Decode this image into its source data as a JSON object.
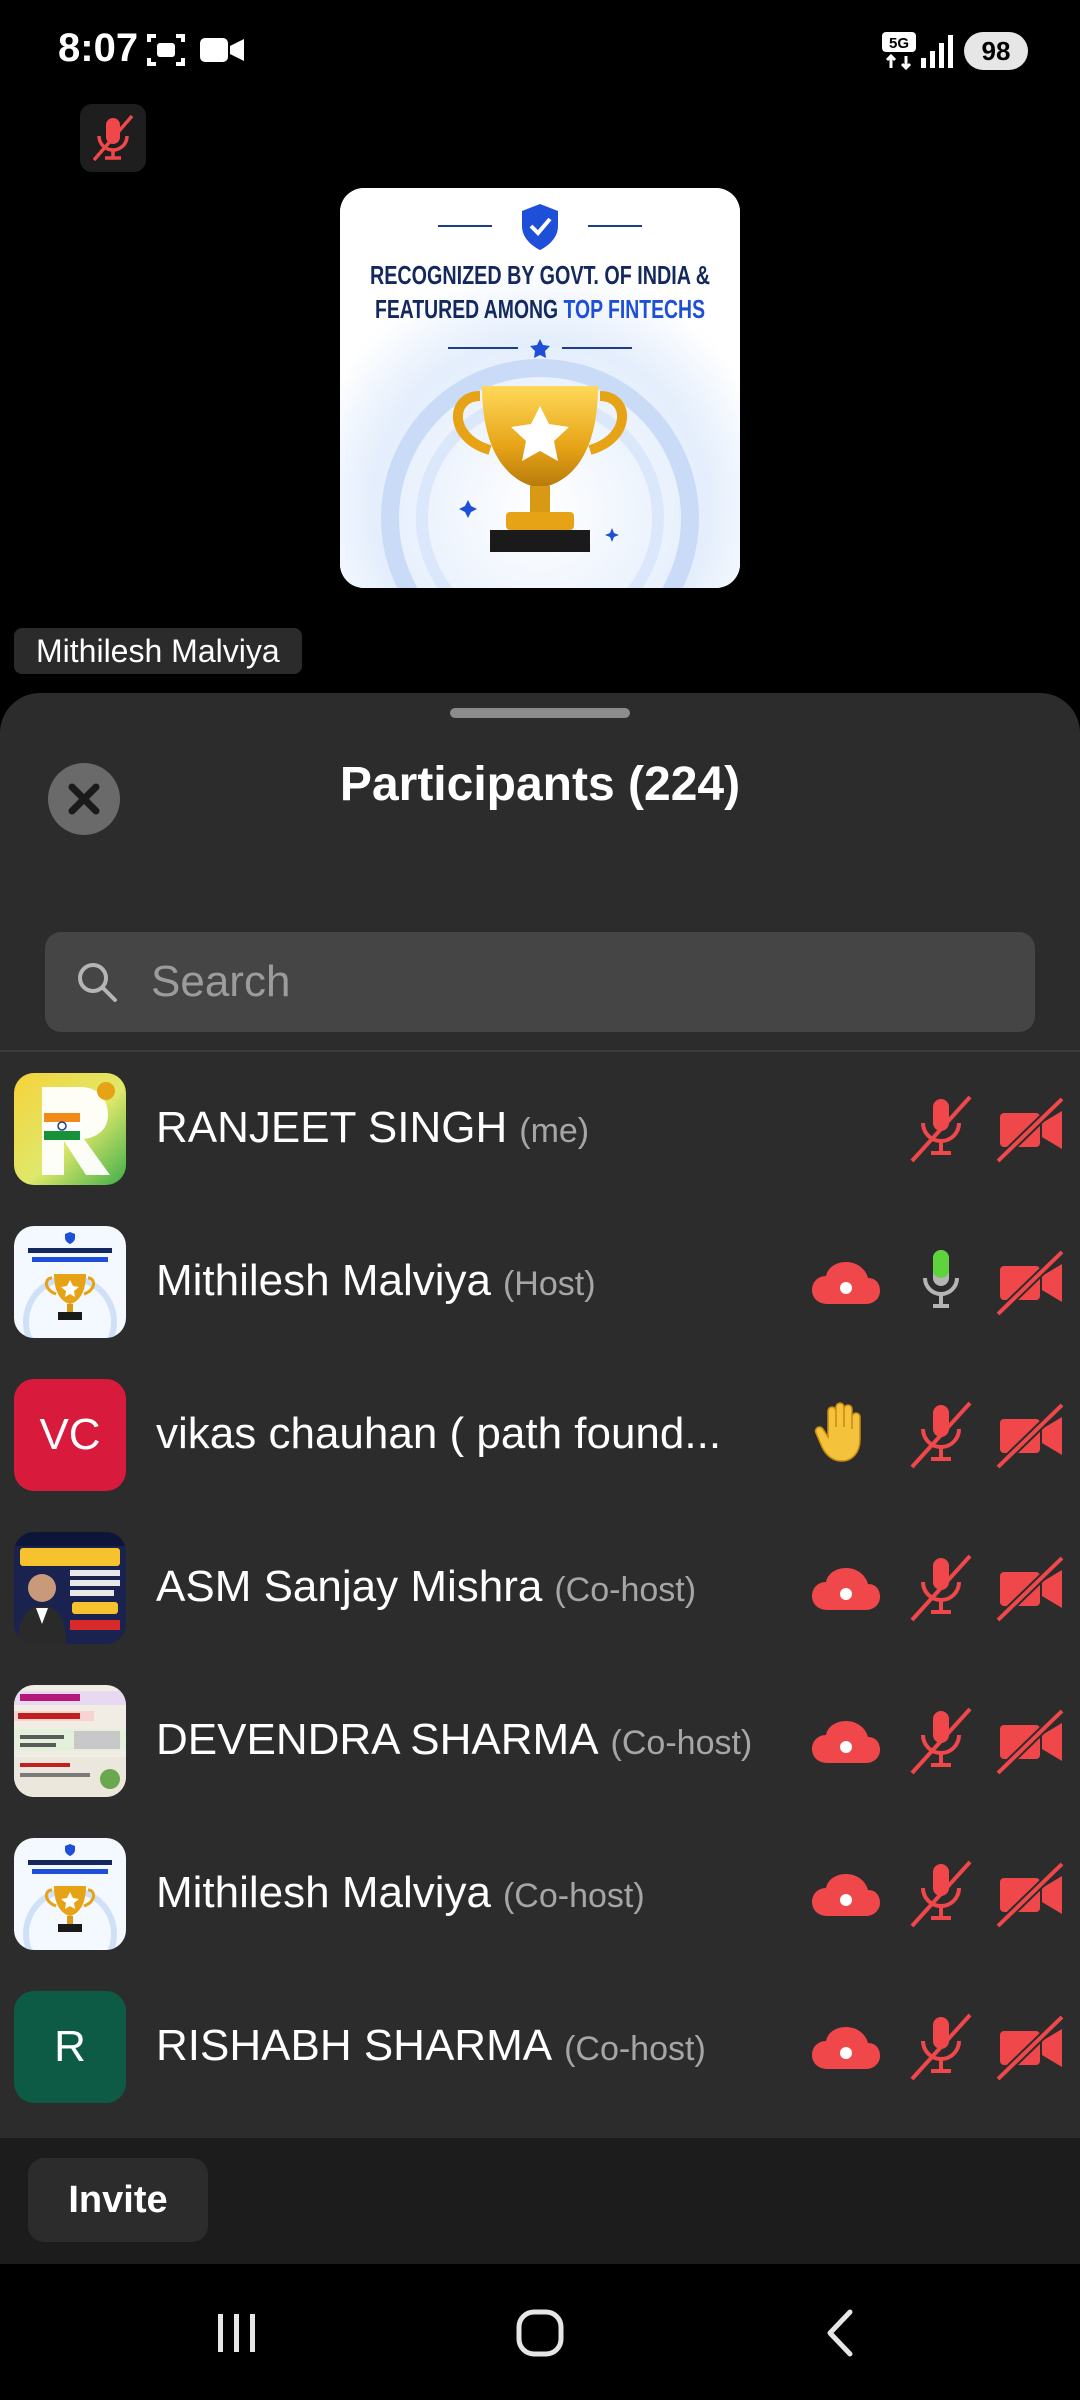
{
  "status_bar": {
    "time": "8:07",
    "network": "5G",
    "battery": "98",
    "icons": [
      "screenshot-icon",
      "video-recording-icon",
      "signal-icon"
    ]
  },
  "stage": {
    "mute_state": "muted",
    "shared_image": {
      "line1": "RECOGNIZED BY GOVT. OF INDIA &",
      "line2a": "FEATURED AMONG ",
      "line2b": "TOP FINTECHS"
    },
    "speaker_name": "Mithilesh Malviya"
  },
  "panel": {
    "title": "Participants (224)",
    "search_placeholder": "Search"
  },
  "participants": [
    {
      "name": "RANJEET SINGH",
      "role": "(me)",
      "avatar": "image",
      "cloud": false,
      "hand": false,
      "mic": "muted",
      "video": "off"
    },
    {
      "name": "Mithilesh Malviya",
      "role": "(Host)",
      "avatar": "image",
      "cloud": true,
      "hand": false,
      "mic": "on",
      "video": "off"
    },
    {
      "name": "vikas chauhan ( path found...",
      "role": "",
      "avatar": "VC",
      "avatar_color": "#d81a3c",
      "cloud": false,
      "hand": true,
      "mic": "muted",
      "video": "off"
    },
    {
      "name": "ASM Sanjay Mishra",
      "role": "(Co-host)",
      "avatar": "image",
      "cloud": true,
      "hand": false,
      "mic": "muted",
      "video": "off"
    },
    {
      "name": "DEVENDRA SHARMA",
      "role": "(Co-host)",
      "avatar": "image",
      "cloud": true,
      "hand": false,
      "mic": "muted",
      "video": "off"
    },
    {
      "name": "Mithilesh Malviya",
      "role": "(Co-host)",
      "avatar": "image",
      "cloud": true,
      "hand": false,
      "mic": "muted",
      "video": "off"
    },
    {
      "name": "RISHABH SHARMA",
      "role": "(Co-host)",
      "avatar": "R",
      "avatar_color": "#0d5a45",
      "cloud": true,
      "hand": false,
      "mic": "muted",
      "video": "off"
    }
  ],
  "footer": {
    "invite_label": "Invite"
  },
  "colors": {
    "muted_red": "#f0474b",
    "mic_on_green": "#5fd33c",
    "sheet_bg": "#2c2c2c"
  }
}
